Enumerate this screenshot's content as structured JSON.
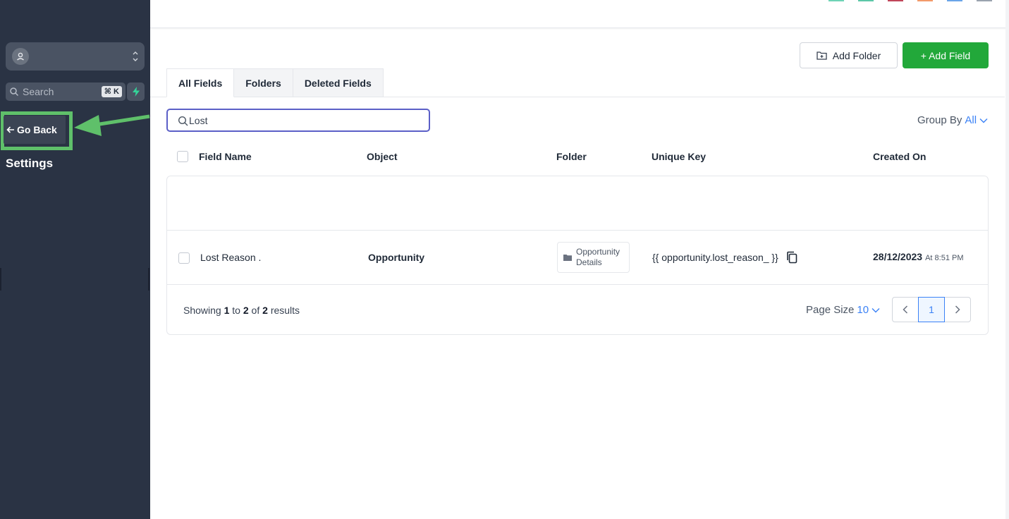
{
  "sidebar": {
    "search_placeholder": "Search",
    "search_shortcut": "⌘ K",
    "go_back_label": "Go Back",
    "settings_title": "Settings"
  },
  "toolbar": {
    "add_folder_label": "Add Folder",
    "add_field_label": "+ Add Field"
  },
  "tabs": [
    {
      "label": "All Fields",
      "active": true
    },
    {
      "label": "Folders",
      "active": false
    },
    {
      "label": "Deleted Fields",
      "active": false
    }
  ],
  "field_search": {
    "value": "Lost"
  },
  "group_by": {
    "label": "Group By",
    "value": "All"
  },
  "table": {
    "columns": [
      "Field Name",
      "Object",
      "Folder",
      "Unique Key",
      "Created On"
    ],
    "rows": [
      {
        "field_name": "Lost Reason .",
        "object": "Opportunity",
        "folder": "Opportunity Details",
        "unique_key": "{{ opportunity.lost_reason_ }}",
        "created_date": "28/12/2023",
        "created_time": "At 8:51 PM"
      }
    ]
  },
  "footer": {
    "showing_prefix": "Showing",
    "from": "1",
    "to_word": "to",
    "to": "2",
    "of_word": "of",
    "total": "2",
    "results_word": "results",
    "page_size_label": "Page Size",
    "page_size_value": "10",
    "current_page": "1"
  },
  "colors": {
    "sidebar_bg": "#2a3344",
    "primary_green": "#22a83a",
    "highlight_green": "#5fc06a",
    "accent_blue": "#3b82f6",
    "search_focus": "#5b5fc7"
  }
}
